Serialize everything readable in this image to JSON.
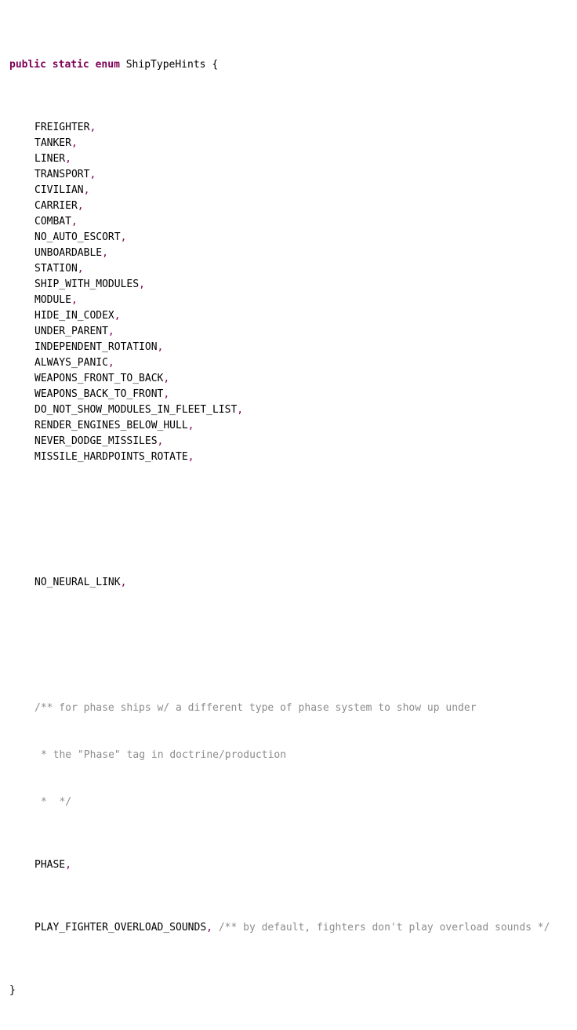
{
  "declaration": {
    "modifier_public": "public",
    "modifier_static": "static",
    "keyword_enum": "enum",
    "name": "ShipTypeHints",
    "open_brace": "{"
  },
  "constants_group1": [
    "FREIGHTER",
    "TANKER",
    "LINER",
    "TRANSPORT",
    "CIVILIAN",
    "CARRIER",
    "COMBAT",
    "NO_AUTO_ESCORT",
    "UNBOARDABLE",
    "STATION",
    "SHIP_WITH_MODULES",
    "MODULE",
    "HIDE_IN_CODEX",
    "UNDER_PARENT",
    "INDEPENDENT_ROTATION",
    "ALWAYS_PANIC",
    "WEAPONS_FRONT_TO_BACK",
    "WEAPONS_BACK_TO_FRONT",
    "DO_NOT_SHOW_MODULES_IN_FLEET_LIST",
    "RENDER_ENGINES_BELOW_HULL",
    "NEVER_DODGE_MISSILES",
    "MISSILE_HARDPOINTS_ROTATE"
  ],
  "constant_neural": "NO_NEURAL_LINK",
  "doc_comment": {
    "line1": "/** for phase ships w/ a different type of phase system to show up under",
    "line2": "* the \"Phase\" tag in doctrine/production",
    "line3": "*  */"
  },
  "constant_phase": "PHASE",
  "constant_last": "PLAY_FIGHTER_OVERLOAD_SOUNDS",
  "trailing_comment": "/** by default, fighters don't play overload sounds */",
  "comma": ",",
  "close_brace": "}"
}
